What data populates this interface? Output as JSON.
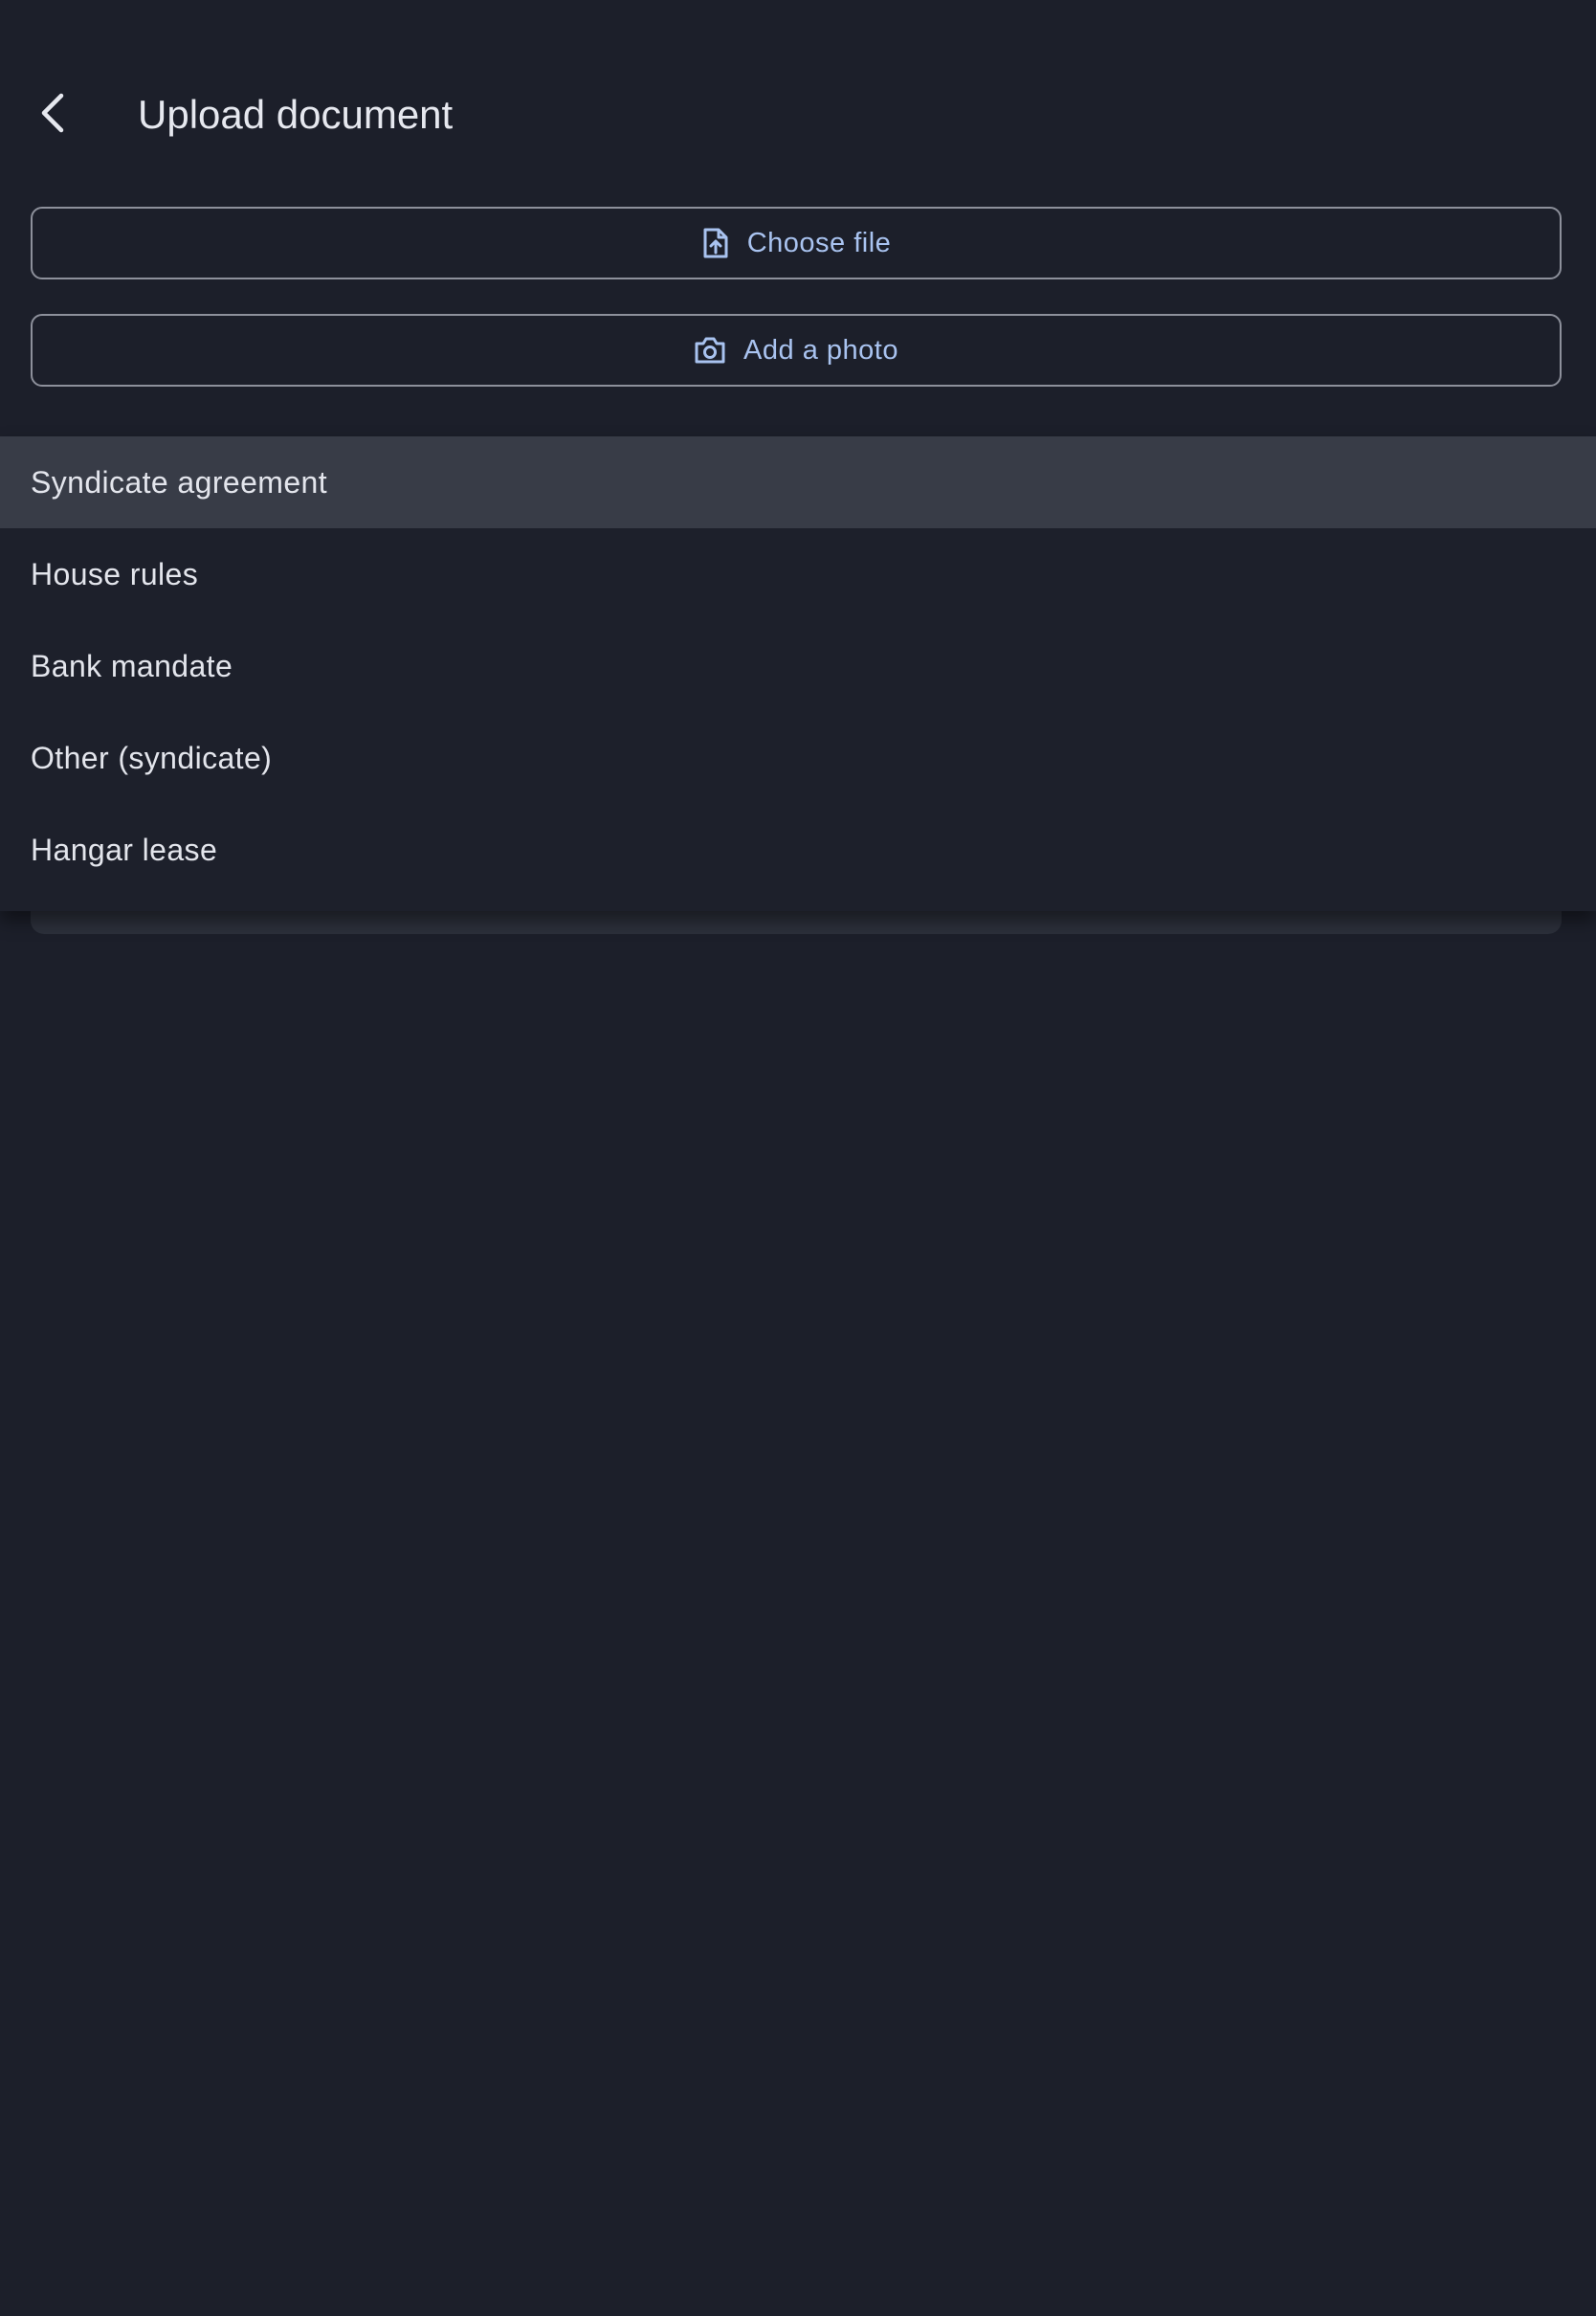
{
  "header": {
    "title": "Upload document",
    "back_icon": "chevron-left-icon"
  },
  "actions": {
    "choose_file": {
      "label": "Choose file",
      "icon": "file-upload-icon"
    },
    "add_photo": {
      "label": "Add a photo",
      "icon": "camera-icon"
    }
  },
  "document_type_menu": {
    "selected": "Syndicate agreement",
    "items": [
      {
        "label": "Syndicate agreement"
      },
      {
        "label": "House rules"
      },
      {
        "label": "Bank mandate"
      },
      {
        "label": "Other (syndicate)"
      },
      {
        "label": "Hangar lease"
      }
    ]
  },
  "colors": {
    "background": "#1c1f2a",
    "accent_text": "#a9c3f0",
    "selected_item_bg": "#383c47",
    "outline": "#8d909b"
  }
}
